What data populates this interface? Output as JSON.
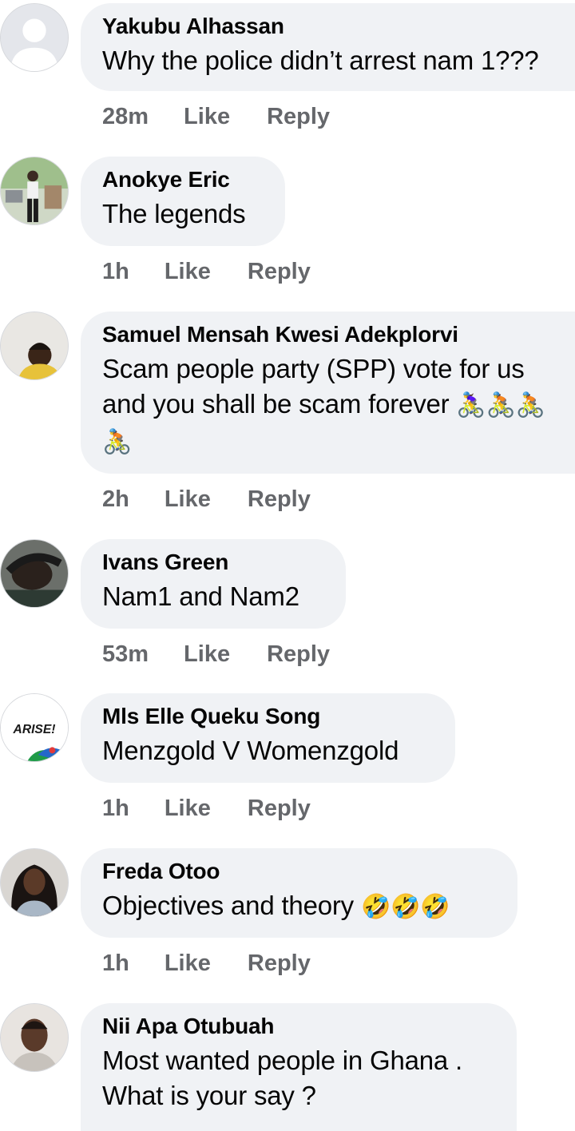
{
  "actions": {
    "like_label": "Like",
    "reply_label": "Reply"
  },
  "comments": [
    {
      "author": "Yakubu Alhassan",
      "text": "Why the police didn’t arrest nam 1???",
      "time": "28m",
      "avatar": "default-avatar"
    },
    {
      "author": "Anokye Eric",
      "text": "The legends",
      "time": "1h",
      "avatar": "photo-avatar"
    },
    {
      "author": "Samuel Mensah Kwesi Adekplorvi",
      "text": "Scam people party (SPP)  vote for us and you shall be scam forever",
      "emoji": "🚴‍♀️🚴🚴🚴",
      "time": "2h",
      "avatar": "photo-avatar"
    },
    {
      "author": "Ivans Green",
      "text": "Nam1 and Nam2",
      "time": "53m",
      "avatar": "photo-avatar"
    },
    {
      "author": "Mls Elle Queku Song",
      "text": "Menzgold V Womenzgold",
      "time": "1h",
      "avatar": "arise-logo-avatar",
      "logo_text": "ARISE!"
    },
    {
      "author": "Freda Otoo",
      "text": "Objectives and theory",
      "emoji": "🤣🤣🤣",
      "time": "1h",
      "avatar": "photo-avatar"
    },
    {
      "author": "Nii Apa Otubuah",
      "text": "Most wanted people in Ghana . What is your say ?",
      "time": "",
      "avatar": "photo-avatar"
    }
  ],
  "colors": {
    "bubble": "#f0f2f5",
    "meta": "#65676b",
    "text": "#050505"
  }
}
